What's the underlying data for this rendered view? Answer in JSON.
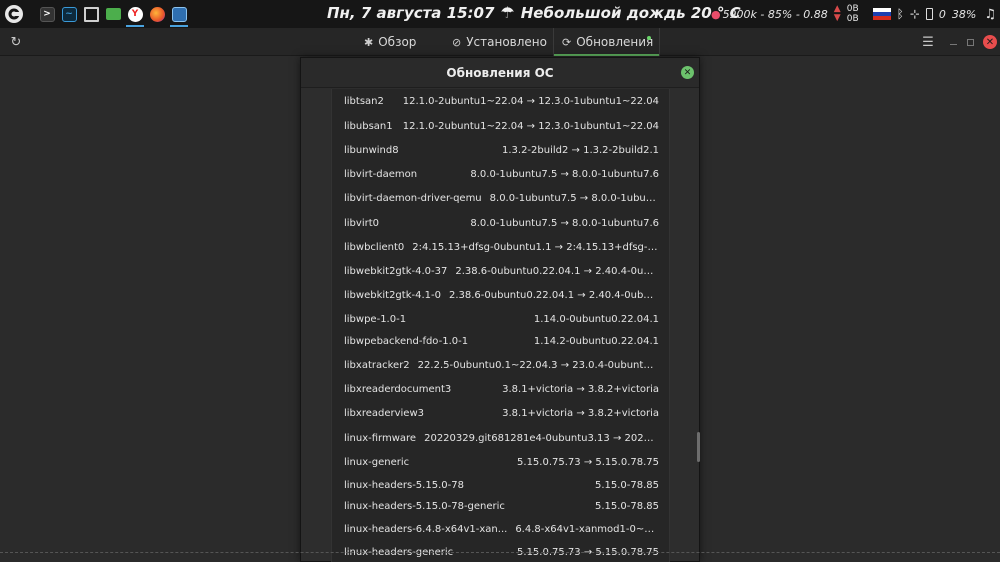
{
  "panel": {
    "clock": "Пн, 7 августа 15:07",
    "weather": "Небольшой дождь 20 ° C",
    "weather_icon": "cloud-rain-icon",
    "tray": {
      "stats": "5900k - 85% - 0.88",
      "net_up": "0B",
      "net_down": "0B",
      "battery_num": "0",
      "battery_pct": "38%"
    },
    "tasks": [
      "terminal",
      "system-monitor",
      "screenshot",
      "files",
      "yandex-browser",
      "firefox",
      "software-manager"
    ]
  },
  "toolbar": {
    "tabs": [
      {
        "label": "Обзор",
        "icon": "asterisk-icon"
      },
      {
        "label": "Установлено",
        "icon": "check-circle-icon"
      },
      {
        "label": "Обновления",
        "icon": "refresh-icon"
      }
    ],
    "accent": "#5fb15f"
  },
  "dialog": {
    "title": "Обновления ОС",
    "packages": [
      {
        "name": "libtsan2",
        "version": "12.1.0-2ubuntu1~22.04 → 12.3.0-1ubuntu1~22.04"
      },
      {
        "name": "libubsan1",
        "version": "12.1.0-2ubuntu1~22.04 → 12.3.0-1ubuntu1~22.04"
      },
      {
        "name": "libunwind8",
        "version": "1.3.2-2build2 → 1.3.2-2build2.1"
      },
      {
        "name": "libvirt-daemon",
        "version": "8.0.0-1ubuntu7.5 → 8.0.0-1ubuntu7.6"
      },
      {
        "name": "libvirt-daemon-driver-qemu",
        "version": "8.0.0-1ubuntu7.5 → 8.0.0-1ubuntu7.6"
      },
      {
        "name": "libvirt0",
        "version": "8.0.0-1ubuntu7.5 → 8.0.0-1ubuntu7.6"
      },
      {
        "name": "libwbclient0",
        "version": "2:4.15.13+dfsg-0ubuntu1.1 → 2:4.15.13+dfsg-0ubun..."
      },
      {
        "name": "libwebkit2gtk-4.0-37",
        "version": "2.38.6-0ubuntu0.22.04.1 → 2.40.4-0ubuntu0..."
      },
      {
        "name": "libwebkit2gtk-4.1-0",
        "version": "2.38.6-0ubuntu0.22.04.1 → 2.40.4-0ubuntu0...."
      },
      {
        "name": "libwpe-1.0-1",
        "version": "1.14.0-0ubuntu0.22.04.1"
      },
      {
        "name": "libwpebackend-fdo-1.0-1",
        "version": "1.14.2-0ubuntu0.22.04.1"
      },
      {
        "name": "libxatracker2",
        "version": "22.2.5-0ubuntu0.1~22.04.3 → 23.0.4-0ubuntu1~22...."
      },
      {
        "name": "libxreaderdocument3",
        "version": "3.8.1+victoria → 3.8.2+victoria"
      },
      {
        "name": "libxreaderview3",
        "version": "3.8.1+victoria → 3.8.2+victoria"
      },
      {
        "name": "linux-firmware",
        "version": "20220329.git681281e4-0ubuntu3.13 → 20220329...."
      },
      {
        "name": "linux-generic",
        "version": "5.15.0.75.73 → 5.15.0.78.75"
      },
      {
        "name": "linux-headers-5.15.0-78",
        "version": "5.15.0-78.85"
      },
      {
        "name": "linux-headers-5.15.0-78-generic",
        "version": "5.15.0-78.85"
      },
      {
        "name": "linux-headers-6.4.8-x64v1-xan...",
        "version": "6.4.8-x64v1-xanmod1-0~20230..."
      },
      {
        "name": "linux-headers-generic",
        "version": "5.15.0.75.73 → 5.15.0.78.75"
      }
    ]
  }
}
